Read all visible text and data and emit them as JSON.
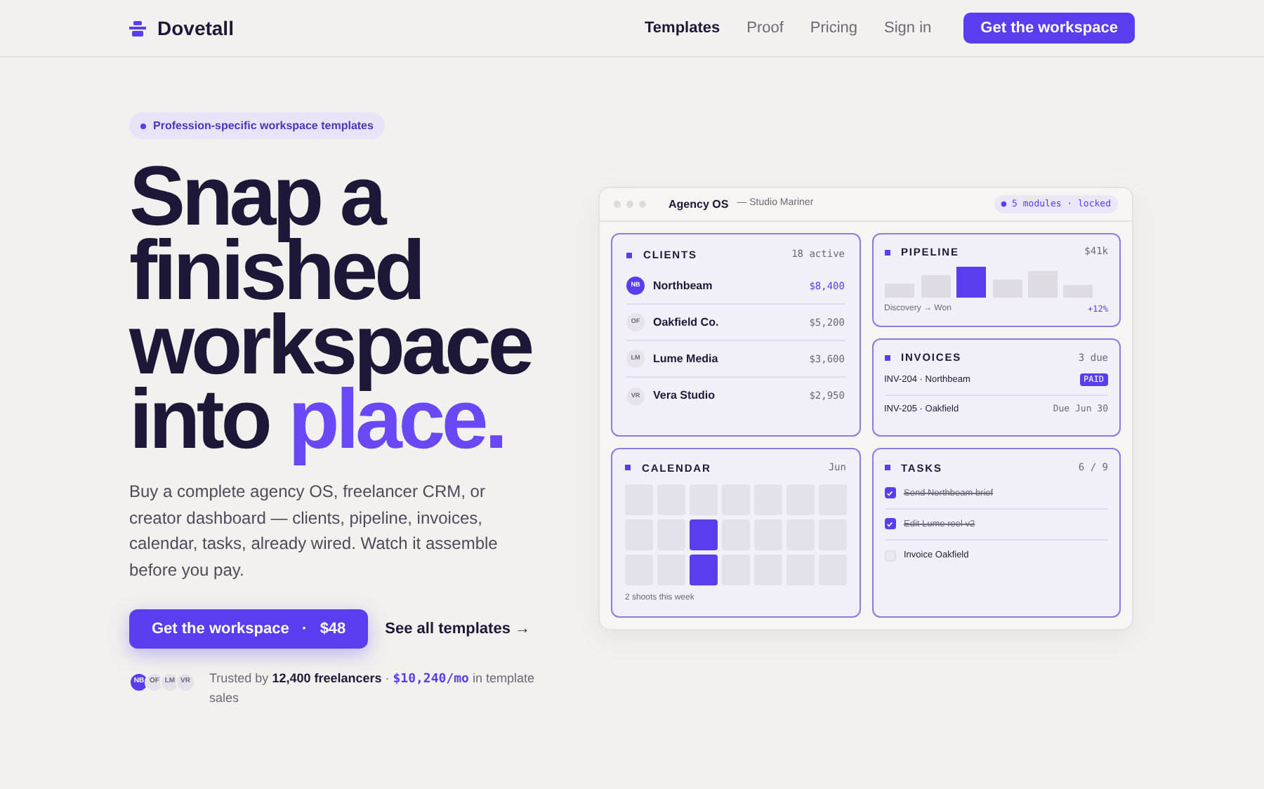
{
  "nav": {
    "brand": "Dovetall",
    "links": [
      {
        "label": "Templates",
        "selected": true
      },
      {
        "label": "Proof",
        "selected": false
      },
      {
        "label": "Pricing",
        "selected": false
      },
      {
        "label": "Sign in",
        "selected": false
      }
    ],
    "cta": "Get the workspace"
  },
  "hero": {
    "badge": "Profession-specific workspace templates",
    "headline": [
      [
        {
          "text": "Snap a",
          "accent": false
        }
      ],
      [
        {
          "text": "finished",
          "accent": false
        }
      ],
      [
        {
          "text": "workspace",
          "accent": false
        }
      ],
      [
        {
          "text": "into ",
          "accent": false
        },
        {
          "text": "place.",
          "accent": true
        }
      ]
    ],
    "body": "Buy a complete agency OS, freelancer CRM, or creator dashboard — clients, pipeline, invoices, calendar, tasks, already wired. Watch it assemble before you pay.",
    "primary": {
      "label": "Get the workspace",
      "sep": "·",
      "price": "$48"
    },
    "secondary": "See all templates →",
    "avatars": [
      {
        "initials": "NB",
        "selected": true
      },
      {
        "initials": "OF",
        "selected": false
      },
      {
        "initials": "LM",
        "selected": false
      },
      {
        "initials": "VR",
        "selected": false
      }
    ],
    "trust": {
      "prefix": "Trusted by ",
      "bold": "12,400 freelancers",
      "sep": " · ",
      "mono": "$10,240/mo",
      "suffix": " in template sales"
    }
  },
  "dashboard": {
    "title": "Agency OS",
    "subtitle": "— Studio Mariner",
    "status_dot": "●",
    "status": "5 modules · locked",
    "clients": {
      "title": "CLIENTS",
      "meta": "18 active",
      "rows": [
        {
          "initials": "NB",
          "name": "Northbeam",
          "amount": "$8,400",
          "selected": true
        },
        {
          "initials": "OF",
          "name": "Oakfield Co.",
          "amount": "$5,200",
          "selected": false
        },
        {
          "initials": "LM",
          "name": "Lume Media",
          "amount": "$3,600",
          "selected": false
        },
        {
          "initials": "VR",
          "name": "Vera Studio",
          "amount": "$2,950",
          "selected": false
        }
      ]
    },
    "pipeline": {
      "title": "PIPELINE",
      "meta": "$41k",
      "caption": "Discovery → Won",
      "change": "+12%"
    },
    "invoices": {
      "title": "INVOICES",
      "meta": "3 due",
      "rows": [
        {
          "label": "INV-204 · Northbeam",
          "status": "PAID",
          "kind": "badge"
        },
        {
          "label": "INV-205 · Oakfield",
          "status": "Due Jun 30",
          "kind": "text"
        }
      ]
    },
    "calendar": {
      "title": "CALENDAR",
      "meta": "Jun",
      "caption": "2 shoots this week",
      "cells": [
        {
          "selected": false
        },
        {
          "selected": false
        },
        {
          "selected": false
        },
        {
          "selected": false
        },
        {
          "selected": false
        },
        {
          "selected": false
        },
        {
          "selected": false
        },
        {
          "selected": false
        },
        {
          "selected": false
        },
        {
          "selected": true
        },
        {
          "selected": false
        },
        {
          "selected": false
        },
        {
          "selected": false
        },
        {
          "selected": false
        },
        {
          "selected": false
        },
        {
          "selected": false
        },
        {
          "selected": true
        },
        {
          "selected": false
        },
        {
          "selected": false
        },
        {
          "selected": false
        },
        {
          "selected": false
        }
      ]
    },
    "tasks": {
      "title": "TASKS",
      "meta": "6 / 9",
      "items": [
        {
          "label": "Send Northbeam brief",
          "checked": true
        },
        {
          "label": "Edit Lume reel v2",
          "checked": true
        },
        {
          "label": "Invoice Oakfield",
          "checked": false
        }
      ]
    }
  }
}
